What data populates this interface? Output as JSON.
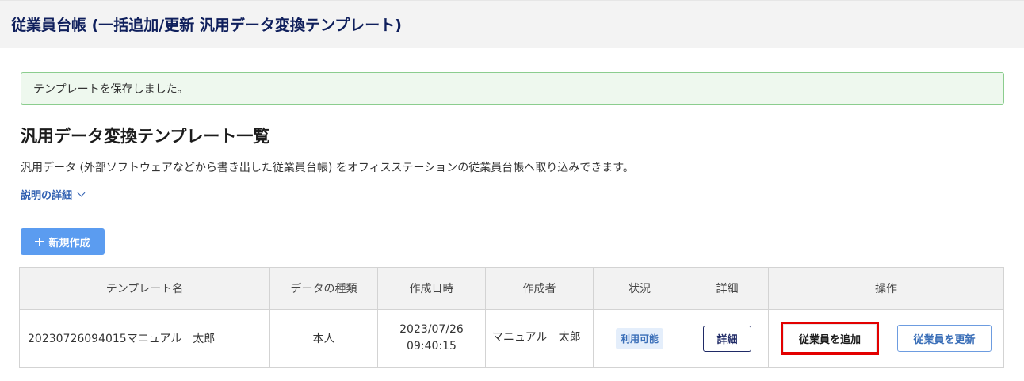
{
  "header": {
    "title": "従業員台帳 (一括追加/更新 汎用データ変換テンプレート)"
  },
  "alert": {
    "message": "テンプレートを保存しました。"
  },
  "section": {
    "title": "汎用データ変換テンプレート一覧",
    "description": "汎用データ (外部ソフトウェアなどから書き出した従業員台帳) をオフィスステーションの従業員台帳へ取り込みできます。",
    "detail_toggle": "説明の詳細"
  },
  "toolbar": {
    "new_label": "新規作成"
  },
  "table": {
    "headers": [
      "テンプレート名",
      "データの種類",
      "作成日時",
      "作成者",
      "状況",
      "詳細",
      "操作"
    ],
    "rows": [
      {
        "name": "20230726094015マニュアル　太郎",
        "data_type": "本人",
        "created_date": "2023/07/26",
        "created_time": "09:40:15",
        "author": "マニュアル　太郎",
        "status": "利用可能",
        "detail_label": "詳細",
        "add_label": "従業員を追加",
        "update_label": "従業員を更新"
      }
    ]
  },
  "colors": {
    "title": "#0f1f5c",
    "accent": "#5b9cf0",
    "highlight": "#e30000",
    "success_bg": "#eef8ee"
  },
  "icons": {
    "toggle": "chevron-down-icon",
    "new": "plus-icon"
  }
}
